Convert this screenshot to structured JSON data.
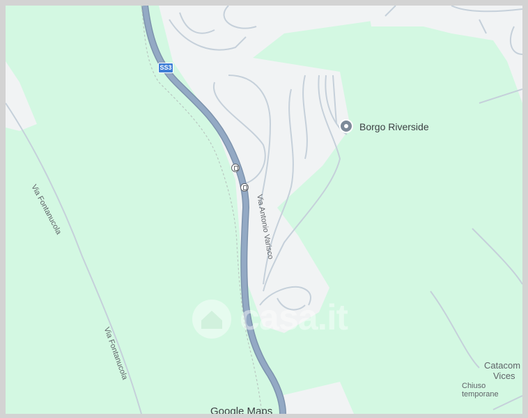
{
  "map": {
    "road_shield": "SS3",
    "poi": {
      "name": "Borgo Riverside",
      "icon": "location-pin-icon"
    },
    "streets": [
      {
        "name": "Via Antonio Varisco"
      },
      {
        "name": "Via Fontanucola"
      },
      {
        "name": "Via Fontanucola"
      }
    ],
    "partial_poi": {
      "name_line1": "Catacom",
      "name_line2": "Vices",
      "status": "Chiuso temporane"
    },
    "attribution": "Google Maps",
    "watermark": "casa.it",
    "colors": {
      "park": "#d3f8e2",
      "urban": "#f1f3f4",
      "highway": "#8fa3bd",
      "minor_road": "#c8d2dc",
      "shield": "#3f7fd6"
    }
  }
}
